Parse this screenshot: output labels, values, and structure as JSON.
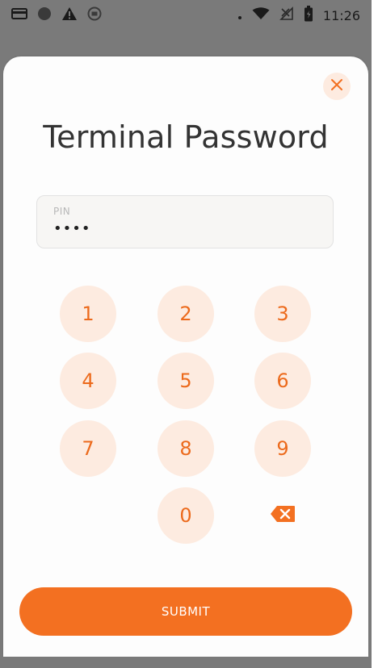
{
  "status_bar": {
    "time": "11:26",
    "left_icons": [
      "card-icon",
      "circle-icon",
      "warning-icon",
      "app-icon"
    ],
    "right_icons": [
      "signal-dot-icon",
      "wifi-icon",
      "no-sim-icon",
      "battery-icon"
    ]
  },
  "dialog": {
    "title": "Terminal Password",
    "close_icon": "close-icon",
    "pin": {
      "label": "PIN",
      "value": "••••"
    },
    "keypad": {
      "keys": [
        "1",
        "2",
        "3",
        "4",
        "5",
        "6",
        "7",
        "8",
        "9",
        "0"
      ],
      "backspace_icon": "backspace-icon"
    },
    "submit_label": "SUBMIT"
  },
  "colors": {
    "accent": "#f37021",
    "key_background": "#fdebe0",
    "key_text": "#ec6a1c",
    "title_text": "#333333",
    "backdrop": "#7a7a7a"
  }
}
